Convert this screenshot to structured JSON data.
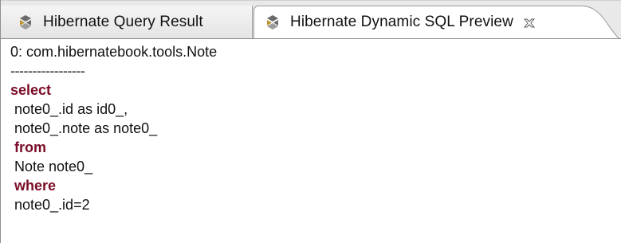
{
  "tabs": [
    {
      "label": "Hibernate Query Result",
      "active": false
    },
    {
      "label": "Hibernate Dynamic SQL Preview",
      "active": true
    }
  ],
  "colors": {
    "keyword": "#7a0d26",
    "text": "#111111",
    "tab_bar": "#e9e9e9",
    "border": "#8f8f8f"
  },
  "content": {
    "lines": [
      {
        "text": "0: com.hibernatebook.tools.Note",
        "keyword": false
      },
      {
        "text": "-----------------",
        "keyword": false
      },
      {
        "text": "select",
        "keyword": true
      },
      {
        "text": " note0_.id as id0_,",
        "keyword": false
      },
      {
        "text": " note0_.note as note0_",
        "keyword": false
      },
      {
        "text": " from",
        "keyword": true
      },
      {
        "text": " Note note0_",
        "keyword": false
      },
      {
        "text": " where",
        "keyword": true
      },
      {
        "text": " note0_.id=2",
        "keyword": false
      }
    ]
  },
  "icons": {
    "tab_icon": "hibernate-icon",
    "close_icon": "close-icon"
  }
}
